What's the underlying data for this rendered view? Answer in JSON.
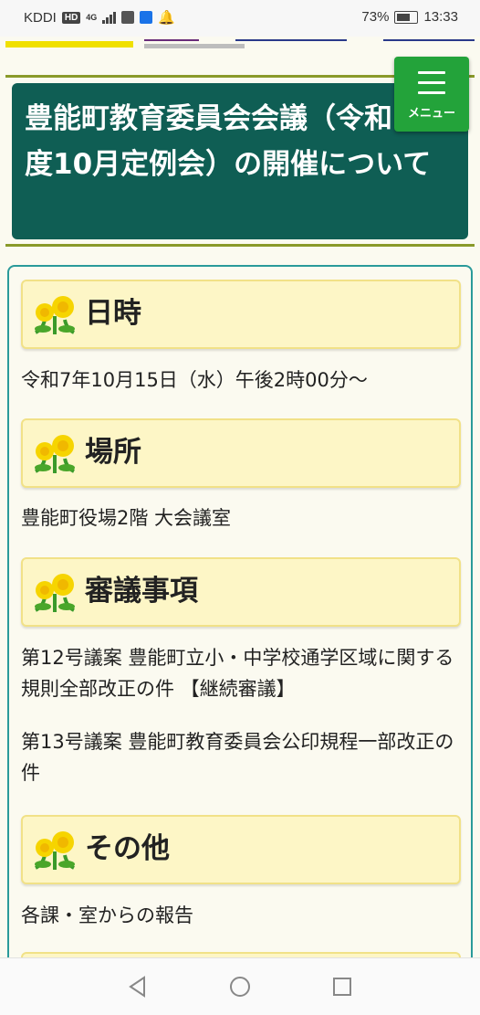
{
  "status_bar": {
    "carrier": "KDDI",
    "hd_badge": "HD",
    "network": "4G",
    "battery": "73%",
    "time": "13:33"
  },
  "page": {
    "title": "豊能町教育委員会会議（令和7年度10月定例会）の開催について",
    "menu_label": "メニュー"
  },
  "sections": [
    {
      "heading": "日時",
      "paragraphs": [
        "令和7年10月15日（水）午後2時00分〜"
      ]
    },
    {
      "heading": "場所",
      "paragraphs": [
        "豊能町役場2階 大会議室"
      ]
    },
    {
      "heading": "審議事項",
      "paragraphs": [
        "第12号議案 豊能町立小・中学校通学区域に関する規則全部改正の件 【継続審議】",
        "第13号議案 豊能町教育委員会公印規程一部改正の件"
      ]
    },
    {
      "heading": "その他",
      "paragraphs": [
        "各課・室からの報告"
      ]
    }
  ],
  "icons": {
    "section_heading": "dandelion-flower-icon",
    "nav_back": "back-triangle-icon",
    "nav_home": "home-circle-icon",
    "nav_recents": "recents-square-icon"
  },
  "colors": {
    "title_background": "#0f5e54",
    "menu_button": "#23a33a",
    "heading_background": "#fdf6c6",
    "content_border": "#2a9a9a"
  }
}
